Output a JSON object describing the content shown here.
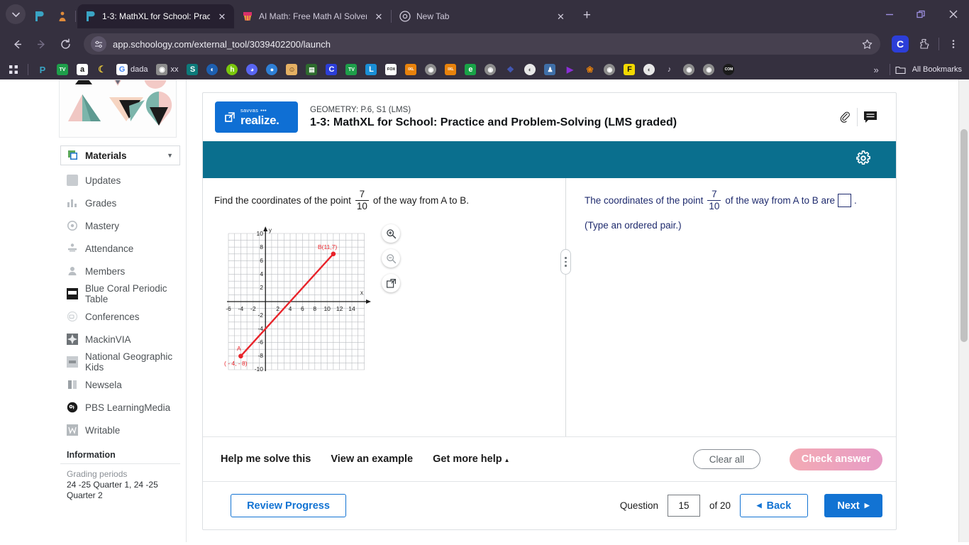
{
  "browser": {
    "tabs": [
      {
        "title": "1-3: MathXL for School: Practic",
        "favicon": "schoology-icon",
        "active": true
      },
      {
        "title": "AI Math: Free Math AI Solver &",
        "favicon": "pi-icon",
        "active": false
      },
      {
        "title": "New Tab",
        "favicon": "chrome-icon",
        "active": false
      }
    ],
    "url": "app.schoology.com/external_tool/3039402200/launch",
    "profile_initial": "C",
    "bookmarks_label": "All Bookmarks",
    "bookmark_items": [
      {
        "label": "",
        "name": "apps-grid-icon",
        "color": "#35303f",
        "glyph": "∷"
      },
      {
        "label": "",
        "name": "schoology-bookmark",
        "color": "#35303f",
        "glyph": "P"
      },
      {
        "label": "",
        "name": "tv-bookmark",
        "color": "#1e9e4a",
        "glyph": "TV"
      },
      {
        "label": "",
        "name": "amazon-bookmark",
        "color": "#ffffff",
        "glyph": "a"
      },
      {
        "label": "",
        "name": "banana-bookmark",
        "color": "#35303f",
        "glyph": "☽"
      },
      {
        "label": "dada",
        "name": "google-dada-bookmark",
        "color": "#ffffff",
        "glyph": "G"
      },
      {
        "label": "xx",
        "name": "globe-xx-bookmark",
        "color": "#8d8d8d",
        "glyph": "●"
      },
      {
        "label": "",
        "name": "s-bookmark",
        "color": "#0d7a7a",
        "glyph": "S"
      },
      {
        "label": "",
        "name": "moon-bookmark",
        "color": "#1d5fb0",
        "glyph": "◐"
      },
      {
        "label": "",
        "name": "h-bookmark",
        "color": "#7ac70c",
        "glyph": "h"
      },
      {
        "label": "",
        "name": "discord-bookmark",
        "color": "#5865f2",
        "glyph": "◑"
      },
      {
        "label": "",
        "name": "blue-drop-bookmark",
        "color": "#2e7fd6",
        "glyph": "●"
      },
      {
        "label": "",
        "name": "avatar-bookmark",
        "color": "#e5b063",
        "glyph": "☺"
      },
      {
        "label": "",
        "name": "green-book-bookmark",
        "color": "#2e6b2e",
        "glyph": "▤"
      },
      {
        "label": "",
        "name": "c-bookmark",
        "color": "#2c3ed8",
        "glyph": "C"
      },
      {
        "label": "",
        "name": "tv2-bookmark",
        "color": "#1e9e4a",
        "glyph": "TV"
      },
      {
        "label": "",
        "name": "l-bookmark",
        "color": "#1a8fd6",
        "glyph": "L"
      },
      {
        "label": "",
        "name": "fox-bookmark",
        "color": "#ffffff",
        "glyph": "FOX"
      },
      {
        "label": "",
        "name": "ixl-bookmark",
        "color": "#e8820c",
        "glyph": "IXL"
      },
      {
        "label": "",
        "name": "globe1-bookmark",
        "color": "#8d8d8d",
        "glyph": "●"
      },
      {
        "label": "",
        "name": "ixl2-bookmark",
        "color": "#e8820c",
        "glyph": "IXL"
      },
      {
        "label": "",
        "name": "e-bookmark",
        "color": "#19a347",
        "glyph": "e"
      },
      {
        "label": "",
        "name": "globe2-bookmark",
        "color": "#8d8d8d",
        "glyph": "●"
      },
      {
        "label": "",
        "name": "quizlet-bookmark",
        "color": "#4257b2",
        "glyph": "❖"
      },
      {
        "label": "",
        "name": "droplet-bookmark",
        "color": "#6d6d6d",
        "glyph": "◐"
      },
      {
        "label": "",
        "name": "person-bookmark",
        "color": "#3f6fa8",
        "glyph": "♟"
      },
      {
        "label": "",
        "name": "play-bookmark",
        "color": "#8b2fd6",
        "glyph": "▶"
      },
      {
        "label": "",
        "name": "photos-bookmark",
        "color": "#e8820c",
        "glyph": "❀"
      },
      {
        "label": "",
        "name": "globe3-bookmark",
        "color": "#8d8d8d",
        "glyph": "●"
      },
      {
        "label": "",
        "name": "f-bookmark",
        "color": "#f2d900",
        "glyph": "F"
      },
      {
        "label": "",
        "name": "droplet2-bookmark",
        "color": "#6d6d6d",
        "glyph": "◐"
      },
      {
        "label": "",
        "name": "j-bookmark",
        "color": "#35303f",
        "glyph": "♪"
      },
      {
        "label": "",
        "name": "globe4-bookmark",
        "color": "#8d8d8d",
        "glyph": "●"
      },
      {
        "label": "",
        "name": "globe5-bookmark",
        "color": "#8d8d8d",
        "glyph": "●"
      },
      {
        "label": "",
        "name": "com-bookmark",
        "color": "#1b1b1b",
        "glyph": "COM"
      }
    ]
  },
  "sidebar": {
    "materials_label": "Materials",
    "items": [
      {
        "label": "Updates",
        "icon": "updates-icon"
      },
      {
        "label": "Grades",
        "icon": "grades-icon"
      },
      {
        "label": "Mastery",
        "icon": "mastery-icon"
      },
      {
        "label": "Attendance",
        "icon": "attendance-icon"
      },
      {
        "label": "Members",
        "icon": "members-icon"
      },
      {
        "label": "Blue Coral Periodic Table",
        "icon": "periodic-table-icon"
      },
      {
        "label": "Conferences",
        "icon": "conferences-icon"
      },
      {
        "label": "MackinVIA",
        "icon": "mackinvia-icon"
      },
      {
        "label": "National Geographic Kids",
        "icon": "natgeo-icon"
      },
      {
        "label": "Newsela",
        "icon": "newsela-icon"
      },
      {
        "label": "PBS LearningMedia",
        "icon": "pbs-icon"
      },
      {
        "label": "Writable",
        "icon": "writable-icon"
      }
    ],
    "information_heading": "Information",
    "grading_periods_label": "Grading periods",
    "grading_periods_value": "24 -25 Quarter 1, 24 -25 Quarter 2"
  },
  "card": {
    "logo_savvas": "savvas",
    "logo_word": "realize.",
    "course_line": "GEOMETRY: P.6, S1 (LMS)",
    "title": "1-3: MathXL for School: Practice and Problem-Solving (LMS graded)",
    "attach_icon": "paperclip-icon",
    "comment_icon": "comment-icon",
    "settings_icon": "gear-icon",
    "accent_teal": "#0a6f8e",
    "accent_blue": "#1273d3"
  },
  "question": {
    "prompt_before": "Find the coordinates of the point",
    "fraction_numerator": "7",
    "fraction_denominator": "10",
    "prompt_after": "of the way from A to B.",
    "answer_before": "The coordinates of the point",
    "answer_after": "of the way from A to B are",
    "answer_period": ".",
    "answer_value": "",
    "type_hint": "(Type an ordered pair.)"
  },
  "graph_tools": [
    {
      "name": "zoom-in-icon"
    },
    {
      "name": "zoom-out-icon"
    },
    {
      "name": "expand-icon"
    }
  ],
  "chart_data": {
    "type": "scatter",
    "title": "",
    "xlabel": "x",
    "ylabel": "y",
    "xlim": [
      -7,
      15
    ],
    "ylim": [
      -10,
      10
    ],
    "xticks": [
      -6,
      -4,
      -2,
      2,
      4,
      6,
      8,
      10,
      12,
      14
    ],
    "yticks": [
      10,
      8,
      6,
      4,
      2,
      -2,
      -4,
      -6,
      -8,
      -10
    ],
    "grid": true,
    "series": [
      {
        "name": "segment-AB",
        "color": "#e8232a",
        "points": [
          {
            "label": "A",
            "sublabel": "( - 4, - 8)",
            "x": -4,
            "y": -8
          },
          {
            "label": "B(11,7)",
            "sublabel": "",
            "x": 11,
            "y": 7
          }
        ]
      }
    ]
  },
  "actions": {
    "help_me_solve": "Help me solve this",
    "view_example": "View an example",
    "get_more_help": "Get more help",
    "clear_all": "Clear all",
    "check_answer": "Check answer"
  },
  "footer": {
    "review_progress": "Review Progress",
    "question_label": "Question",
    "question_number": "15",
    "of_label": "of 20",
    "back": "Back",
    "next": "Next"
  }
}
